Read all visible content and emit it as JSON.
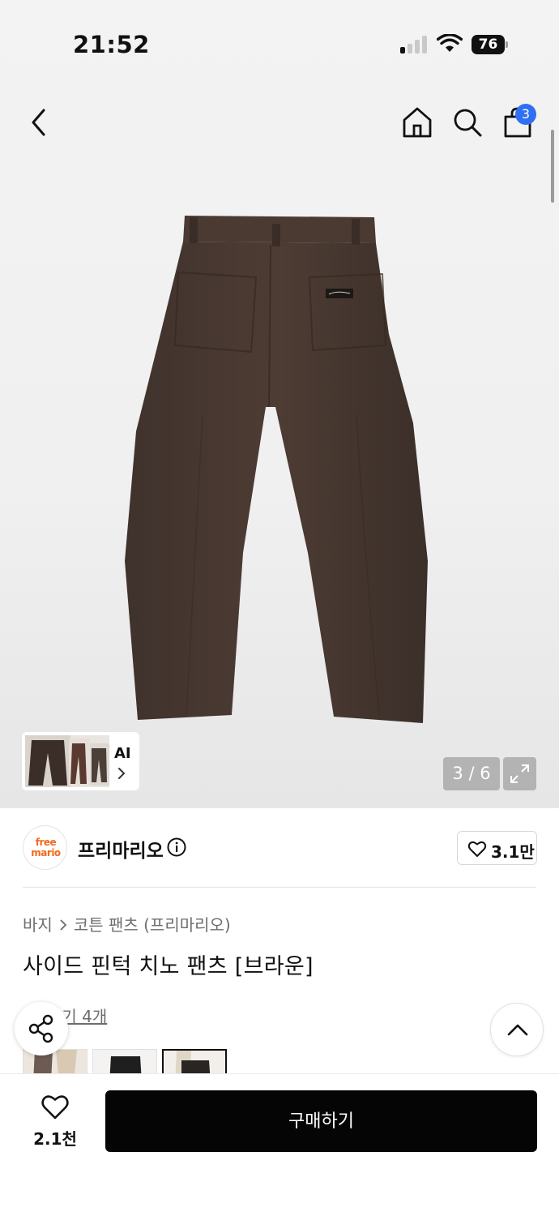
{
  "status_bar": {
    "time": "21:52",
    "battery": "76"
  },
  "header": {
    "cart_badge": "3"
  },
  "gallery": {
    "ai_label": "AI",
    "counter": "3 / 6"
  },
  "brand": {
    "logo_line1": "free",
    "logo_line2": "mario",
    "name": "프리마리오",
    "likes": "3.1만"
  },
  "product": {
    "breadcrumb": [
      "바지",
      "코튼 팬츠 (프리마리오)"
    ],
    "title": "사이드 핀턱 치노 팬츠 [브라운]",
    "reviews_link": "후기 4개"
  },
  "bottom_bar": {
    "wish_count": "2.1천",
    "buy_label": "구매하기"
  },
  "colors": {
    "badge_blue": "#2f6ff3",
    "buy_button": "#050505",
    "pants_brown": "#4a3a33",
    "logo_orange": "#f26a1c"
  },
  "icons": [
    "back-icon",
    "home-icon",
    "search-icon",
    "bag-icon",
    "expand-icon",
    "info-icon",
    "heart-icon",
    "share-icon",
    "chevron-up-icon",
    "star-icon"
  ]
}
